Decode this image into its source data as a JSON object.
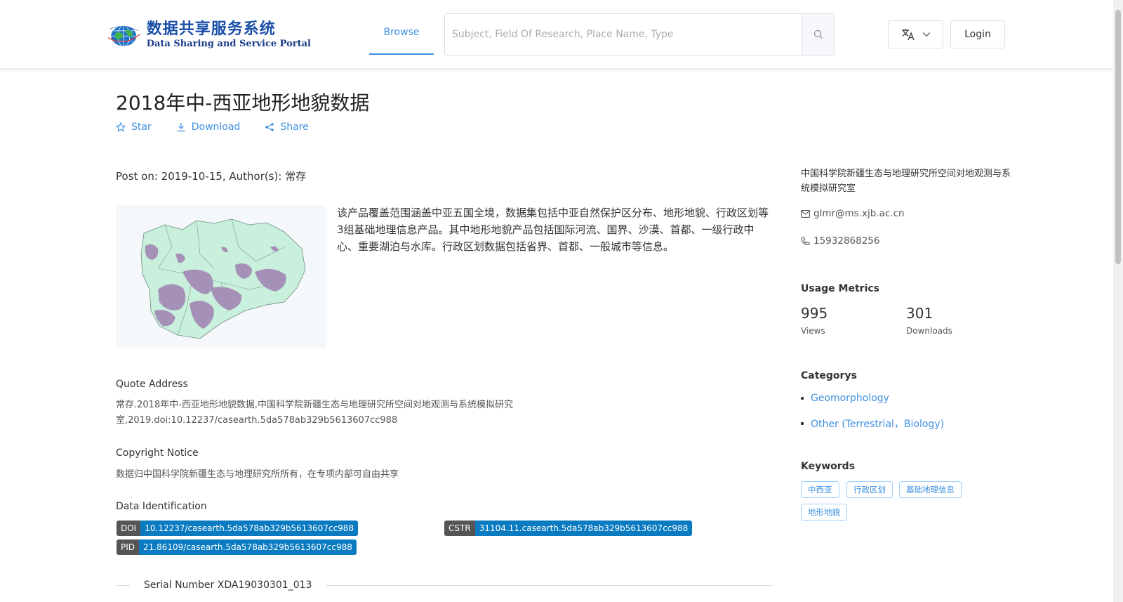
{
  "header": {
    "logo_cn": "数据共享服务系统",
    "logo_en": "Data Sharing and Service Portal",
    "nav_browse": "Browse",
    "search_placeholder": "Subject, Field Of Research, Place Name, Type",
    "login_label": "Login"
  },
  "dataset": {
    "title": "2018年中-西亚地形地貌数据",
    "actions": {
      "star": "Star",
      "download": "Download",
      "share": "Share"
    },
    "post_line": "Post on: 2019-10-15, Author(s): 常存",
    "description": "该产品覆盖范围涵盖中亚五国全境，数据集包括中亚自然保护区分布、地形地貌、行政区划等3组基础地理信息产品。其中地形地貌产品包括国际河流、国界、沙漠、首都、一级行政中心、重要湖泊与水库。行政区划数据包括省界、首都、一般城市等信息。",
    "quote_heading": "Quote Address",
    "quote_text": "常存.2018年中-西亚地形地貌数据,中国科学院新疆生态与地理研究所空间对地观测与系统模拟研究室,2019.doi:10.12237/casearth.5da578ab329b5613607cc988",
    "copyright_heading": "Copyright Notice",
    "copyright_text": "数据归中国科学院新疆生态与地理研究所所有，在专项内部可自由共享",
    "identification_heading": "Data Identification",
    "identifiers": {
      "doi": {
        "key": "DOI",
        "value": "10.12237/casearth.5da578ab329b5613607cc988"
      },
      "cstr": {
        "key": "CSTR",
        "value": "31104.11.casearth.5da578ab329b5613607cc988"
      },
      "pid": {
        "key": "PID",
        "value": "21.86109/casearth.5da578ab329b5613607cc988"
      }
    },
    "serial_number": "Serial Number XDA19030301_013"
  },
  "sidebar": {
    "organization": "中国科学院新疆生态与地理研究所空间对地观测与系统模拟研究室",
    "email": "glmr@ms.xjb.ac.cn",
    "phone": "15932868256",
    "usage_heading": "Usage Metrics",
    "views": {
      "value": "995",
      "label": "Views"
    },
    "downloads": {
      "value": "301",
      "label": "Downloads"
    },
    "categories_heading": "Categorys",
    "categories": [
      "Geomorphology",
      "Other (Terrestrial，Biology)"
    ],
    "keywords_heading": "Keywords",
    "keywords": [
      "中西亚",
      "行政区划",
      "基础地理信息",
      "地形地貌"
    ]
  },
  "colors": {
    "accent": "#3d8fe0",
    "badge_key": "#555555",
    "badge_value": "#0a7bc1",
    "map_land": "#c9f0dc",
    "map_terrain": "#a591b8"
  }
}
